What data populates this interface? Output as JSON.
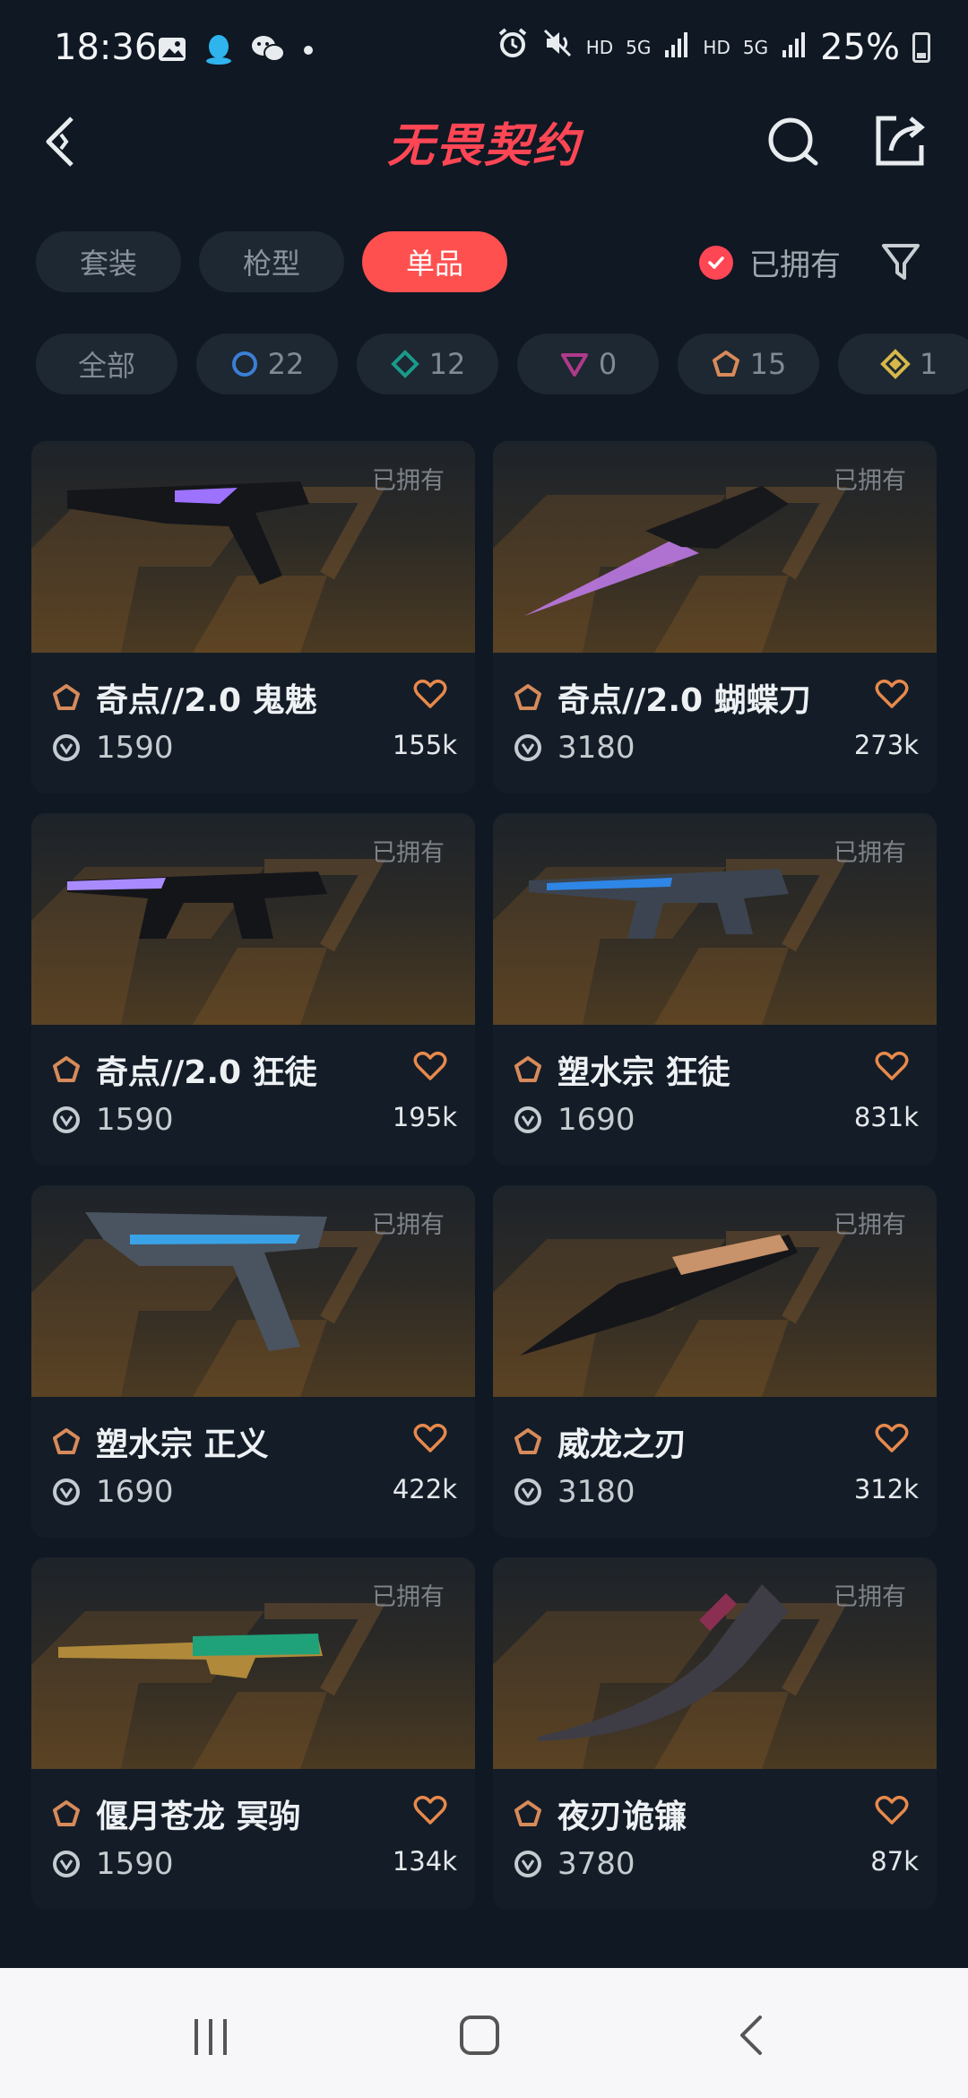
{
  "status_bar": {
    "time": "18:36",
    "net_1": "HD",
    "sig_1": "5G",
    "net_2": "HD",
    "sig_2": "5G",
    "battery": "25%"
  },
  "header": {
    "title": "无畏契约",
    "icons": [
      "back-icon",
      "search-icon",
      "share-icon"
    ]
  },
  "tabs": [
    {
      "label": "套装",
      "active": false
    },
    {
      "label": "枪型",
      "active": false
    },
    {
      "label": "单品",
      "active": true
    }
  ],
  "owned_filter": {
    "label": "已拥有",
    "checked": true
  },
  "chips": [
    {
      "label": "全部"
    },
    {
      "count": "22",
      "icon": "select-tier-icon",
      "color": "#3b7fd6"
    },
    {
      "count": "12",
      "icon": "deluxe-tier-icon",
      "color": "#1a9a8a"
    },
    {
      "count": "0",
      "icon": "premium-tier-icon",
      "color": "#b03a8a"
    },
    {
      "count": "15",
      "icon": "exclusive-tier-icon",
      "color": "#d78a5a"
    },
    {
      "count": "1",
      "icon": "ultra-tier-icon",
      "color": "#d6b84a"
    }
  ],
  "items": [
    {
      "owned": "已拥有",
      "name": "奇点//2.0 鬼魅",
      "price": "1590",
      "likes": "155k",
      "weapon": "pistol",
      "accent": "#9d72ff"
    },
    {
      "owned": "已拥有",
      "name": "奇点//2.0 蝴蝶刀",
      "price": "3180",
      "likes": "273k",
      "weapon": "knife",
      "accent": "#c27cf0"
    },
    {
      "owned": "已拥有",
      "name": "奇点//2.0 狂徒",
      "price": "1590",
      "likes": "195k",
      "weapon": "rifle",
      "accent": "#a98bff"
    },
    {
      "owned": "已拥有",
      "name": "塑水宗 狂徒",
      "price": "1690",
      "likes": "831k",
      "weapon": "rifle2",
      "accent": "#2e86e6"
    },
    {
      "owned": "已拥有",
      "name": "塑水宗 正义",
      "price": "1690",
      "likes": "422k",
      "weapon": "revolver",
      "accent": "#3aa3e8"
    },
    {
      "owned": "已拥有",
      "name": "威龙之刃",
      "price": "3180",
      "likes": "312k",
      "weapon": "blade",
      "accent": "#c8926a"
    },
    {
      "owned": "已拥有",
      "name": "偃月苍龙 冥驹",
      "price": "1590",
      "likes": "134k",
      "weapon": "sniper",
      "accent": "#1fa27a"
    },
    {
      "owned": "已拥有",
      "name": "夜刃诡镰",
      "price": "3780",
      "likes": "87k",
      "weapon": "scythe",
      "accent": "#8a2f52"
    }
  ],
  "nav": [
    "recents-icon",
    "home-icon",
    "back-nav-icon"
  ]
}
